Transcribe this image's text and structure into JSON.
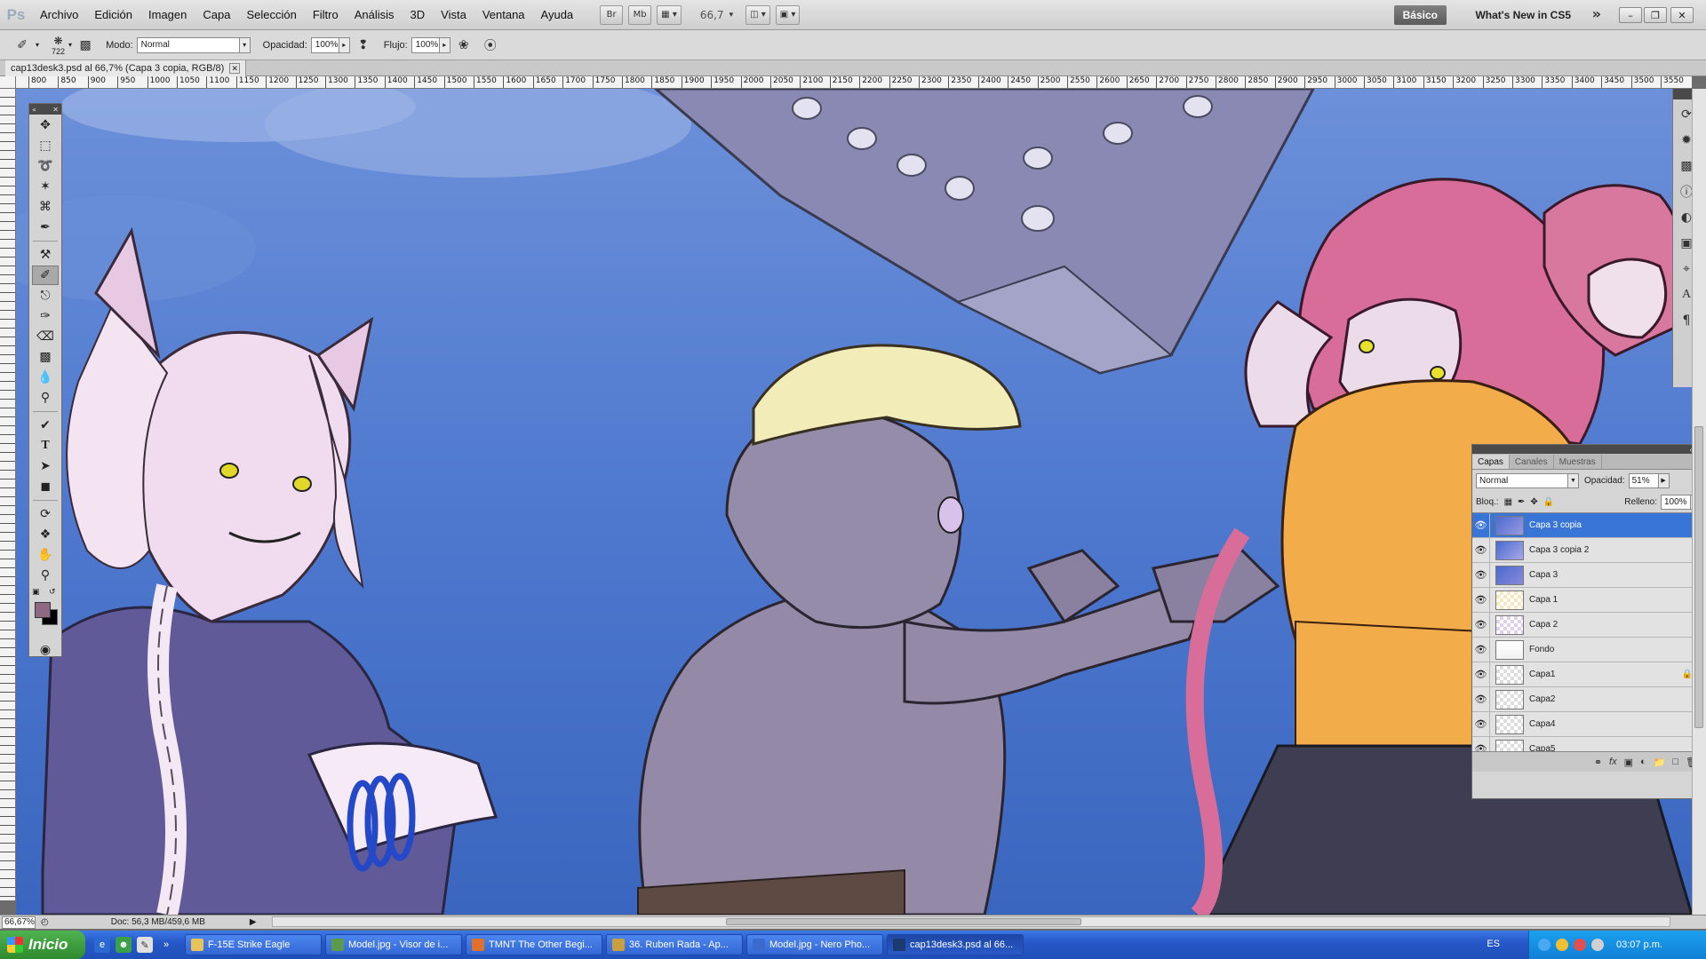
{
  "app": {
    "logo": "Ps",
    "menu": [
      "Archivo",
      "Edición",
      "Imagen",
      "Capa",
      "Selección",
      "Filtro",
      "Análisis",
      "3D",
      "Vista",
      "Ventana",
      "Ayuda"
    ],
    "bridge_label": "Br",
    "minibridge_label": "Mb",
    "zoom_display": "66,7",
    "workspace_basic": "Básico",
    "workspace_new": "What's New in CS5"
  },
  "options": {
    "brush_size": "722",
    "mode_label": "Modo:",
    "mode_value": "Normal",
    "opacity_label": "Opacidad:",
    "opacity_value": "100%",
    "flow_label": "Flujo:",
    "flow_value": "100%"
  },
  "document": {
    "tab_title": "cap13desk3.psd al 66,7% (Capa 3 copia, RGB/8)"
  },
  "ruler_labels": [
    "800",
    "850",
    "900",
    "950",
    "1000",
    "1050",
    "1100",
    "1150",
    "1200",
    "1250",
    "1300",
    "1350",
    "1400",
    "1450",
    "1500",
    "1550",
    "1600",
    "1650",
    "1700",
    "1750",
    "1800",
    "1850",
    "1900",
    "1950",
    "2000",
    "2050",
    "2100",
    "2150",
    "2200",
    "2250",
    "2300",
    "2350",
    "2400",
    "2450",
    "2500",
    "2550",
    "2600",
    "2650",
    "2700",
    "2750",
    "2800",
    "2850",
    "2900",
    "2950",
    "3000",
    "3050",
    "3100",
    "3150",
    "3200",
    "3250",
    "3300",
    "3350",
    "3400",
    "3450",
    "3500",
    "3550"
  ],
  "layers_panel": {
    "tabs": [
      "Capas",
      "Canales",
      "Muestras"
    ],
    "blend_mode": "Normal",
    "opacity_label": "Opacidad:",
    "opacity_value": "51%",
    "lock_label": "Bloq.:",
    "fill_label": "Relleno:",
    "fill_value": "100%",
    "layers": [
      {
        "name": "Capa 3 copia",
        "selected": true,
        "locked": false
      },
      {
        "name": "Capa 3 copia 2",
        "selected": false,
        "locked": false
      },
      {
        "name": "Capa 3",
        "selected": false,
        "locked": false
      },
      {
        "name": "Capa 1",
        "selected": false,
        "locked": false
      },
      {
        "name": "Capa 2",
        "selected": false,
        "locked": false
      },
      {
        "name": "Fondo",
        "selected": false,
        "locked": false
      },
      {
        "name": "Capa1",
        "selected": false,
        "locked": true
      },
      {
        "name": "Capa2",
        "selected": false,
        "locked": false
      },
      {
        "name": "Capa4",
        "selected": false,
        "locked": false
      },
      {
        "name": "Capa5",
        "selected": false,
        "locked": false
      }
    ]
  },
  "status": {
    "zoom": "66,67%",
    "doc_info": "Doc: 56,3 MB/459,6 MB"
  },
  "taskbar": {
    "start_label": "Inicio",
    "tasks": [
      {
        "label": "F-15E Strike Eagle",
        "icon": "folder-icon",
        "color": "#e8c25a"
      },
      {
        "label": "Model.jpg - Visor de i...",
        "icon": "image-viewer-icon",
        "color": "#5a9a4a"
      },
      {
        "label": "TMNT The Other Begi...",
        "icon": "firefox-icon",
        "color": "#e0702a"
      },
      {
        "label": "36. Ruben Rada - Ap...",
        "icon": "winamp-icon",
        "color": "#c8a040"
      },
      {
        "label": "Model.jpg - Nero Pho...",
        "icon": "nero-icon",
        "color": "#3a6ad0"
      },
      {
        "label": "cap13desk3.psd al 66...",
        "icon": "photoshop-icon",
        "color": "#1b3a70"
      }
    ],
    "language": "ES",
    "clock": "03:07 p.m."
  }
}
